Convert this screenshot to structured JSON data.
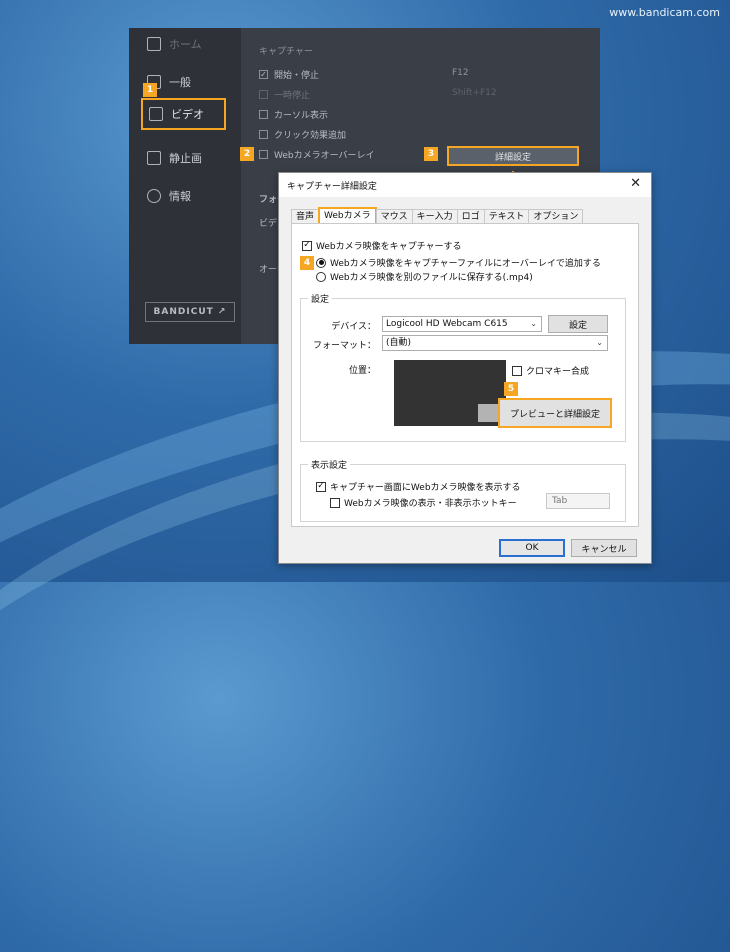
{
  "watermark": "www.bandicam.com",
  "app": {
    "sidebar": {
      "items": [
        {
          "label": "ホーム",
          "icon": "home-icon"
        },
        {
          "label": "一般",
          "icon": "gear-icon"
        },
        {
          "label": "ビデオ",
          "icon": "video-settings-icon"
        },
        {
          "label": "静止画",
          "icon": "image-settings-icon"
        },
        {
          "label": "情報",
          "icon": "info-icon"
        }
      ],
      "brand": "BANDICUT ↗"
    },
    "capture": {
      "section_title": "キャプチャー",
      "options": [
        {
          "label": "開始・停止",
          "checked": true,
          "hotkey": "F12"
        },
        {
          "label": "一時停止",
          "checked": false,
          "hotkey": "Shift+F12"
        },
        {
          "label": "カーソル表示",
          "checked": false
        },
        {
          "label": "クリック効果追加",
          "checked": false
        },
        {
          "label": "Webカメラオーバーレイ",
          "checked": false
        }
      ],
      "advanced_button": "詳細設定",
      "frag_format": "フォー",
      "frag_video": "ビデオ",
      "frag_audio": "オーデ"
    }
  },
  "badges": {
    "b1": "1",
    "b2": "2",
    "b3": "3",
    "b4": "4",
    "b5": "5"
  },
  "dialog": {
    "title": "キャプチャー詳細設定",
    "close": "✕",
    "tabs": [
      "音声",
      "Webカメラ",
      "マウス",
      "キー入力",
      "ロゴ",
      "テキスト",
      "オプション"
    ],
    "active_tab": "Webカメラ",
    "capture_webcam": "Webカメラ映像をキャプチャーする",
    "radio_overlay": "Webカメラ映像をキャプチャーファイルにオーバーレイで追加する",
    "radio_separate": "Webカメラ映像を別のファイルに保存する(.mp4)",
    "settings_group": "設定",
    "device_label": "デバイス：",
    "device_value": "Logicool HD Webcam C615",
    "device_settings_button": "設定",
    "format_label": "フォーマット：",
    "format_value": "(自動)",
    "position_label": "位置：",
    "chroma_key": "クロマキー合成",
    "preview_button": "プレビューと詳細設定",
    "display_group": "表示設定",
    "show_on_screen": "キャプチャー画面にWebカメラ映像を表示する",
    "toggle_hotkey_label": "Webカメラ映像の表示・非表示ホットキー",
    "toggle_hotkey_value": "Tab",
    "ok": "OK",
    "cancel": "キャンセル"
  },
  "colors": {
    "accent": "#f5a623",
    "ok_border": "#2a6fcf"
  }
}
